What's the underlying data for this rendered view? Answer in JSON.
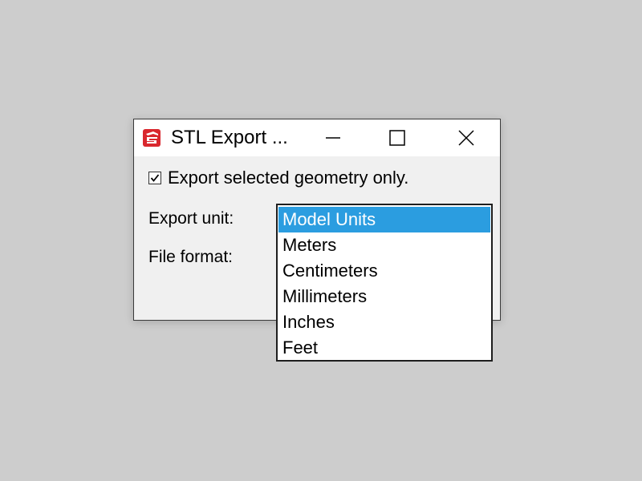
{
  "window": {
    "title": "STL Export ...",
    "icon": "sketchup-logo-icon",
    "controls": {
      "minimize": "minimize-icon",
      "maximize": "maximize-icon",
      "close": "close-icon"
    }
  },
  "options": {
    "export_selected_label": "Export selected geometry only.",
    "export_selected_checked": true,
    "export_unit_label": "Export unit:",
    "file_format_label": "File format:"
  },
  "dropdown": {
    "selected": "Model Units",
    "items": [
      {
        "label": "Model Units"
      },
      {
        "label": "Meters"
      },
      {
        "label": "Centimeters"
      },
      {
        "label": "Millimeters"
      },
      {
        "label": "Inches"
      },
      {
        "label": "Feet"
      }
    ]
  },
  "colors": {
    "background": "#cdcdcd",
    "selection": "#2b9de0",
    "icon_red": "#d9272e"
  }
}
